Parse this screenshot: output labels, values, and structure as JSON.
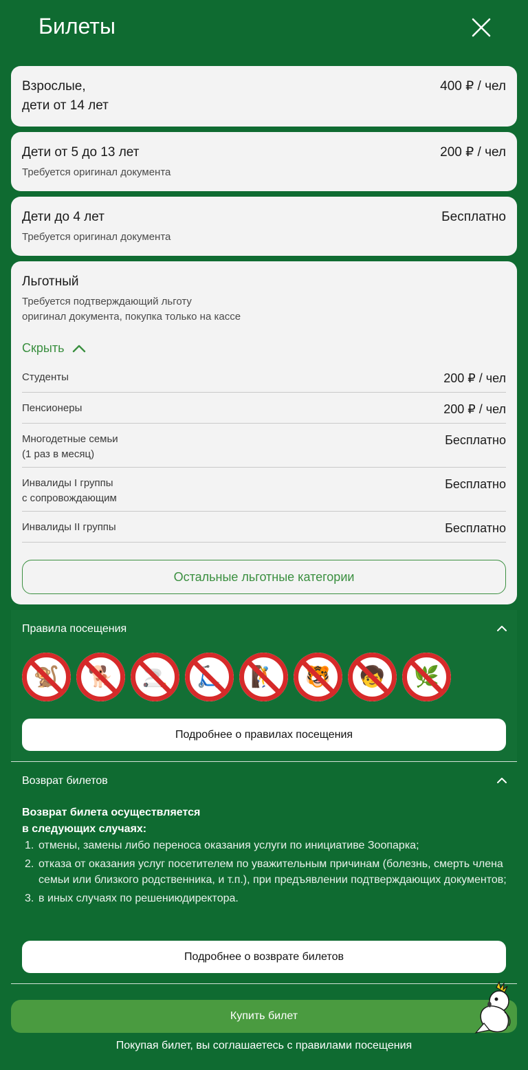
{
  "header": {
    "title": "Билеты"
  },
  "tickets": [
    {
      "title": "Взрослые,\nдети от 14 лет",
      "price": "400  ₽ / чел",
      "note": ""
    },
    {
      "title": "Дети от 5 до 13 лет",
      "price": "200  ₽ / чел",
      "note": "Требуется оригинал документа"
    },
    {
      "title": "Дети до 4 лет",
      "price": "Бесплатно",
      "note": "Требуется оригинал документа"
    }
  ],
  "benefit": {
    "title": "Льготный",
    "note": "Требуется подтверждающий льготу\nоригинал документа, покупка только на кассе",
    "hide_label": "Скрыть",
    "rows": [
      {
        "name": "Студенты",
        "price": "200 ₽ / чел"
      },
      {
        "name": "Пенсионеры",
        "price": "200 ₽ / чел"
      },
      {
        "name": "Многодетные семьи\n(1 раз в месяц)",
        "price": "Бесплатно"
      },
      {
        "name": "Инвалиды I группы\nс сопровождающим",
        "price": "Бесплатно"
      },
      {
        "name": "Инвалиды II группы",
        "price": "Бесплатно"
      }
    ],
    "other_button": "Остальные льготные категории"
  },
  "rules": {
    "title": "Правила посещения",
    "icons": [
      {
        "name": "no-feeding-monkey-icon",
        "glyph": "🐒"
      },
      {
        "name": "no-pets-icon",
        "glyph": "🐕"
      },
      {
        "name": "no-smoking-icon",
        "glyph": "🚬"
      },
      {
        "name": "no-scooters-icon",
        "glyph": "🛴"
      },
      {
        "name": "no-climbing-fence-icon",
        "glyph": "🧗"
      },
      {
        "name": "no-teasing-animals-icon",
        "glyph": "🐯"
      },
      {
        "name": "no-touching-cages-icon",
        "glyph": "🧒"
      },
      {
        "name": "no-picking-plants-icon",
        "glyph": "🌿"
      }
    ],
    "more_button": "Подробнее о правилах посещения"
  },
  "refund": {
    "title": "Возврат билетов",
    "lead": "Возврат билета осуществляется\nв следующих случаях:",
    "items": [
      "отмены, замены либо переноса оказания услуги по инициативе Зоопарка;",
      "отказа от оказания услуг посетителем по уважительным причинам (болезнь, смерть члена семьи или близкого родственника, и т.п.), при предъявлении подтверждающих документов;",
      "в иных случаях по решениюдиректора."
    ],
    "more_button": "Подробнее о возврате билетов"
  },
  "footer": {
    "buy_button": "Купить билет",
    "agree_text": "Покупая билет, вы соглашаетесь с правилами посещения"
  },
  "colors": {
    "background": "#0f6b31",
    "accent": "#3a8f3f",
    "buy_button": "#4a9b40",
    "forbidden": "#d62a2a"
  }
}
